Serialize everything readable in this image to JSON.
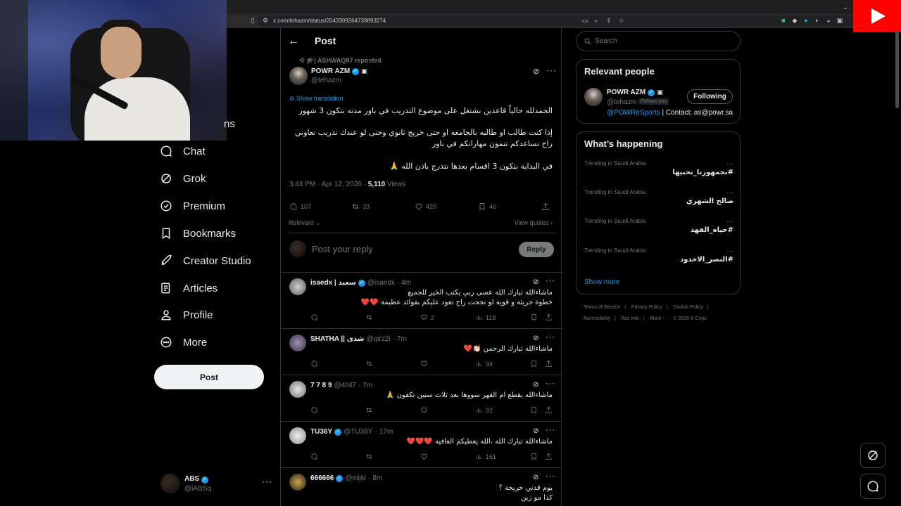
{
  "browser": {
    "url": "x.com/tehazm/status/2043309264739893274"
  },
  "nav": {
    "partial_label": "ns",
    "items": [
      {
        "label": "Chat",
        "icon": "chat-icon"
      },
      {
        "label": "Grok",
        "icon": "grok-icon"
      },
      {
        "label": "Premium",
        "icon": "premium-icon"
      },
      {
        "label": "Bookmarks",
        "icon": "bookmark-icon"
      },
      {
        "label": "Creator Studio",
        "icon": "rocket-icon"
      },
      {
        "label": "Articles",
        "icon": "articles-icon"
      },
      {
        "label": "Profile",
        "icon": "profile-icon"
      },
      {
        "label": "More",
        "icon": "more-circle-icon"
      }
    ],
    "post_button": "Post",
    "account": {
      "name": "ABS",
      "handle": "@iABSq"
    }
  },
  "header": {
    "title": "Post"
  },
  "post": {
    "reposted_by": "🎓| ASHWAQ87 reposted",
    "author_name": "POWR AZM",
    "author_handle": "@tehazm",
    "show_translation": "Show translation",
    "text_lines": [
      "الحمدلله حالياً قاعدين نشتغل على موضوع التدريب في باور مدته بتكون 3 شهور",
      "إذا كنت طالب او طالبه بالجامعه او حتى خريج ثانوي وحتى لو عندك تدريب تعاوني راح نساعدكم تنمون مهاراتكم في باور",
      "في البداية بتكون 3 اقسام بعدها نتدرج باذن الله 🙏"
    ],
    "time": "3:44 PM · Apr 12, 2026 · ",
    "views": "5,110",
    "views_label": " Views",
    "replies": "107",
    "reposts": "33",
    "likes": "420",
    "bookmarks": "46",
    "sort_label": "Relevant",
    "view_quotes": "View quotes",
    "reply_placeholder": "Post your reply",
    "reply_button": "Reply"
  },
  "replies": [
    {
      "name": "isaedx | سعيد",
      "handle": "@isaedx",
      "time": "4m",
      "lines": [
        "ماشاءالله تبارك الله عسى ربي يكتب الخير للجميع",
        "خطوة جريئة و قوية لو نجحت راح تعود عليكم بفوائد عظيمة ❤️❤️"
      ],
      "replies": "",
      "reposts": "",
      "likes": "2",
      "views": "118"
    },
    {
      "name": "SHATHA || شذى",
      "handle": "@qirz2i",
      "time": "7m",
      "lines": [
        "ماشاءالله تبارك الرحمن 👏🏻❤️"
      ],
      "replies": "",
      "reposts": "",
      "likes": "",
      "views": "94"
    },
    {
      "name": "7 7 8 9",
      "handle": "@4hil7",
      "time": "7m",
      "lines": [
        "ماشاءالله يقطع ام القهر سووها بعد ثلاث سنين تكفون 🙏"
      ],
      "replies": "",
      "reposts": "",
      "likes": "",
      "views": "92"
    },
    {
      "name": "TU36Y",
      "handle": "@TU36Y",
      "time": "17m",
      "lines": [
        "ماشاءالله تبارك الله ،الله يعطيكم العافيه ❤️❤️❤️"
      ],
      "replies": "",
      "reposts": "",
      "likes": "",
      "views": "161"
    },
    {
      "name": "666666",
      "handle": "@eiijkl",
      "time": "8m",
      "lines": [
        "يوم قدني خريجة ؟",
        "كذا مو زين"
      ],
      "replies": "",
      "reposts": "",
      "likes": "",
      "views": ""
    }
  ],
  "sidebar": {
    "search_placeholder": "Search",
    "relevant_title": "Relevant people",
    "person": {
      "name": "POWR AZM",
      "handle": "@tehazm",
      "follows_you": "Follows you",
      "button": "Following",
      "bio_link": "@POWReSports",
      "bio_rest": " | Contact: as@powr.sa"
    },
    "happening_title": "What’s happening",
    "trends": [
      {
        "caption": "Trending in Saudi Arabia",
        "tag": "#بجمهورنا_نحبيها"
      },
      {
        "caption": "Trending in Saudi Arabia",
        "tag": "صالح الشهري"
      },
      {
        "caption": "Trending in Saudi Arabia",
        "tag": "#حياه_الفهد"
      },
      {
        "caption": "Trending in Saudi Arabia",
        "tag": "#النصر_الاخدود"
      }
    ],
    "show_more": "Show more",
    "footer_row1": [
      "Terms of Service",
      "|",
      "Privacy Policy",
      "|",
      "Cookie Policy",
      "|"
    ],
    "footer_row2": [
      "Accessibility",
      "|",
      "Ads info",
      "|",
      "More ···",
      "© 2026 X Corp."
    ]
  }
}
